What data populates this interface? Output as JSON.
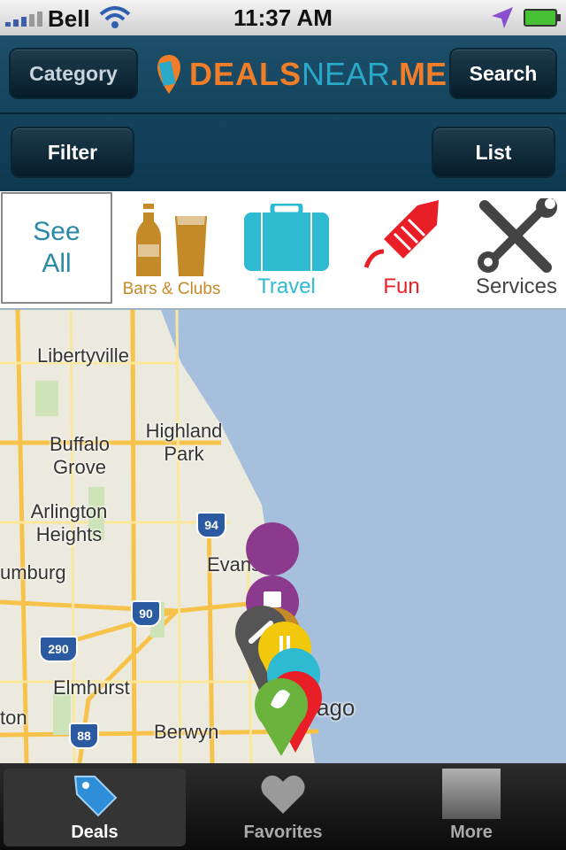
{
  "status_bar": {
    "carrier": "Bell",
    "time": "11:37 AM"
  },
  "header": {
    "category_label": "Category",
    "search_label": "Search",
    "filter_label": "Filter",
    "list_label": "List",
    "logo": {
      "deals": "DEALS",
      "near": "NEAR",
      "me": ".ME"
    }
  },
  "categories": {
    "see_all": "See All",
    "items": [
      {
        "label": "Bars & Clubs",
        "color": "#c48a28"
      },
      {
        "label": "Travel",
        "color": "#2ebad0"
      },
      {
        "label": "Fun",
        "color": "#e81f26"
      },
      {
        "label": "Services",
        "color": "#444444"
      }
    ]
  },
  "map": {
    "places": [
      "Libertyville",
      "Buffalo Grove",
      "Highland Park",
      "Arlington Heights",
      "Evanston",
      "umburg",
      "Elmhurst",
      "Berwyn",
      "ton",
      "Chicago"
    ],
    "highways": [
      "94",
      "90",
      "290",
      "88"
    ],
    "pin_colors": [
      "#8c3a8e",
      "#c48a28",
      "#555555",
      "#f2c80c",
      "#2ebad0",
      "#e81f26",
      "#6ab43e"
    ]
  },
  "tab_bar": {
    "tabs": [
      {
        "label": "Deals"
      },
      {
        "label": "Favorites"
      },
      {
        "label": "More"
      }
    ]
  }
}
